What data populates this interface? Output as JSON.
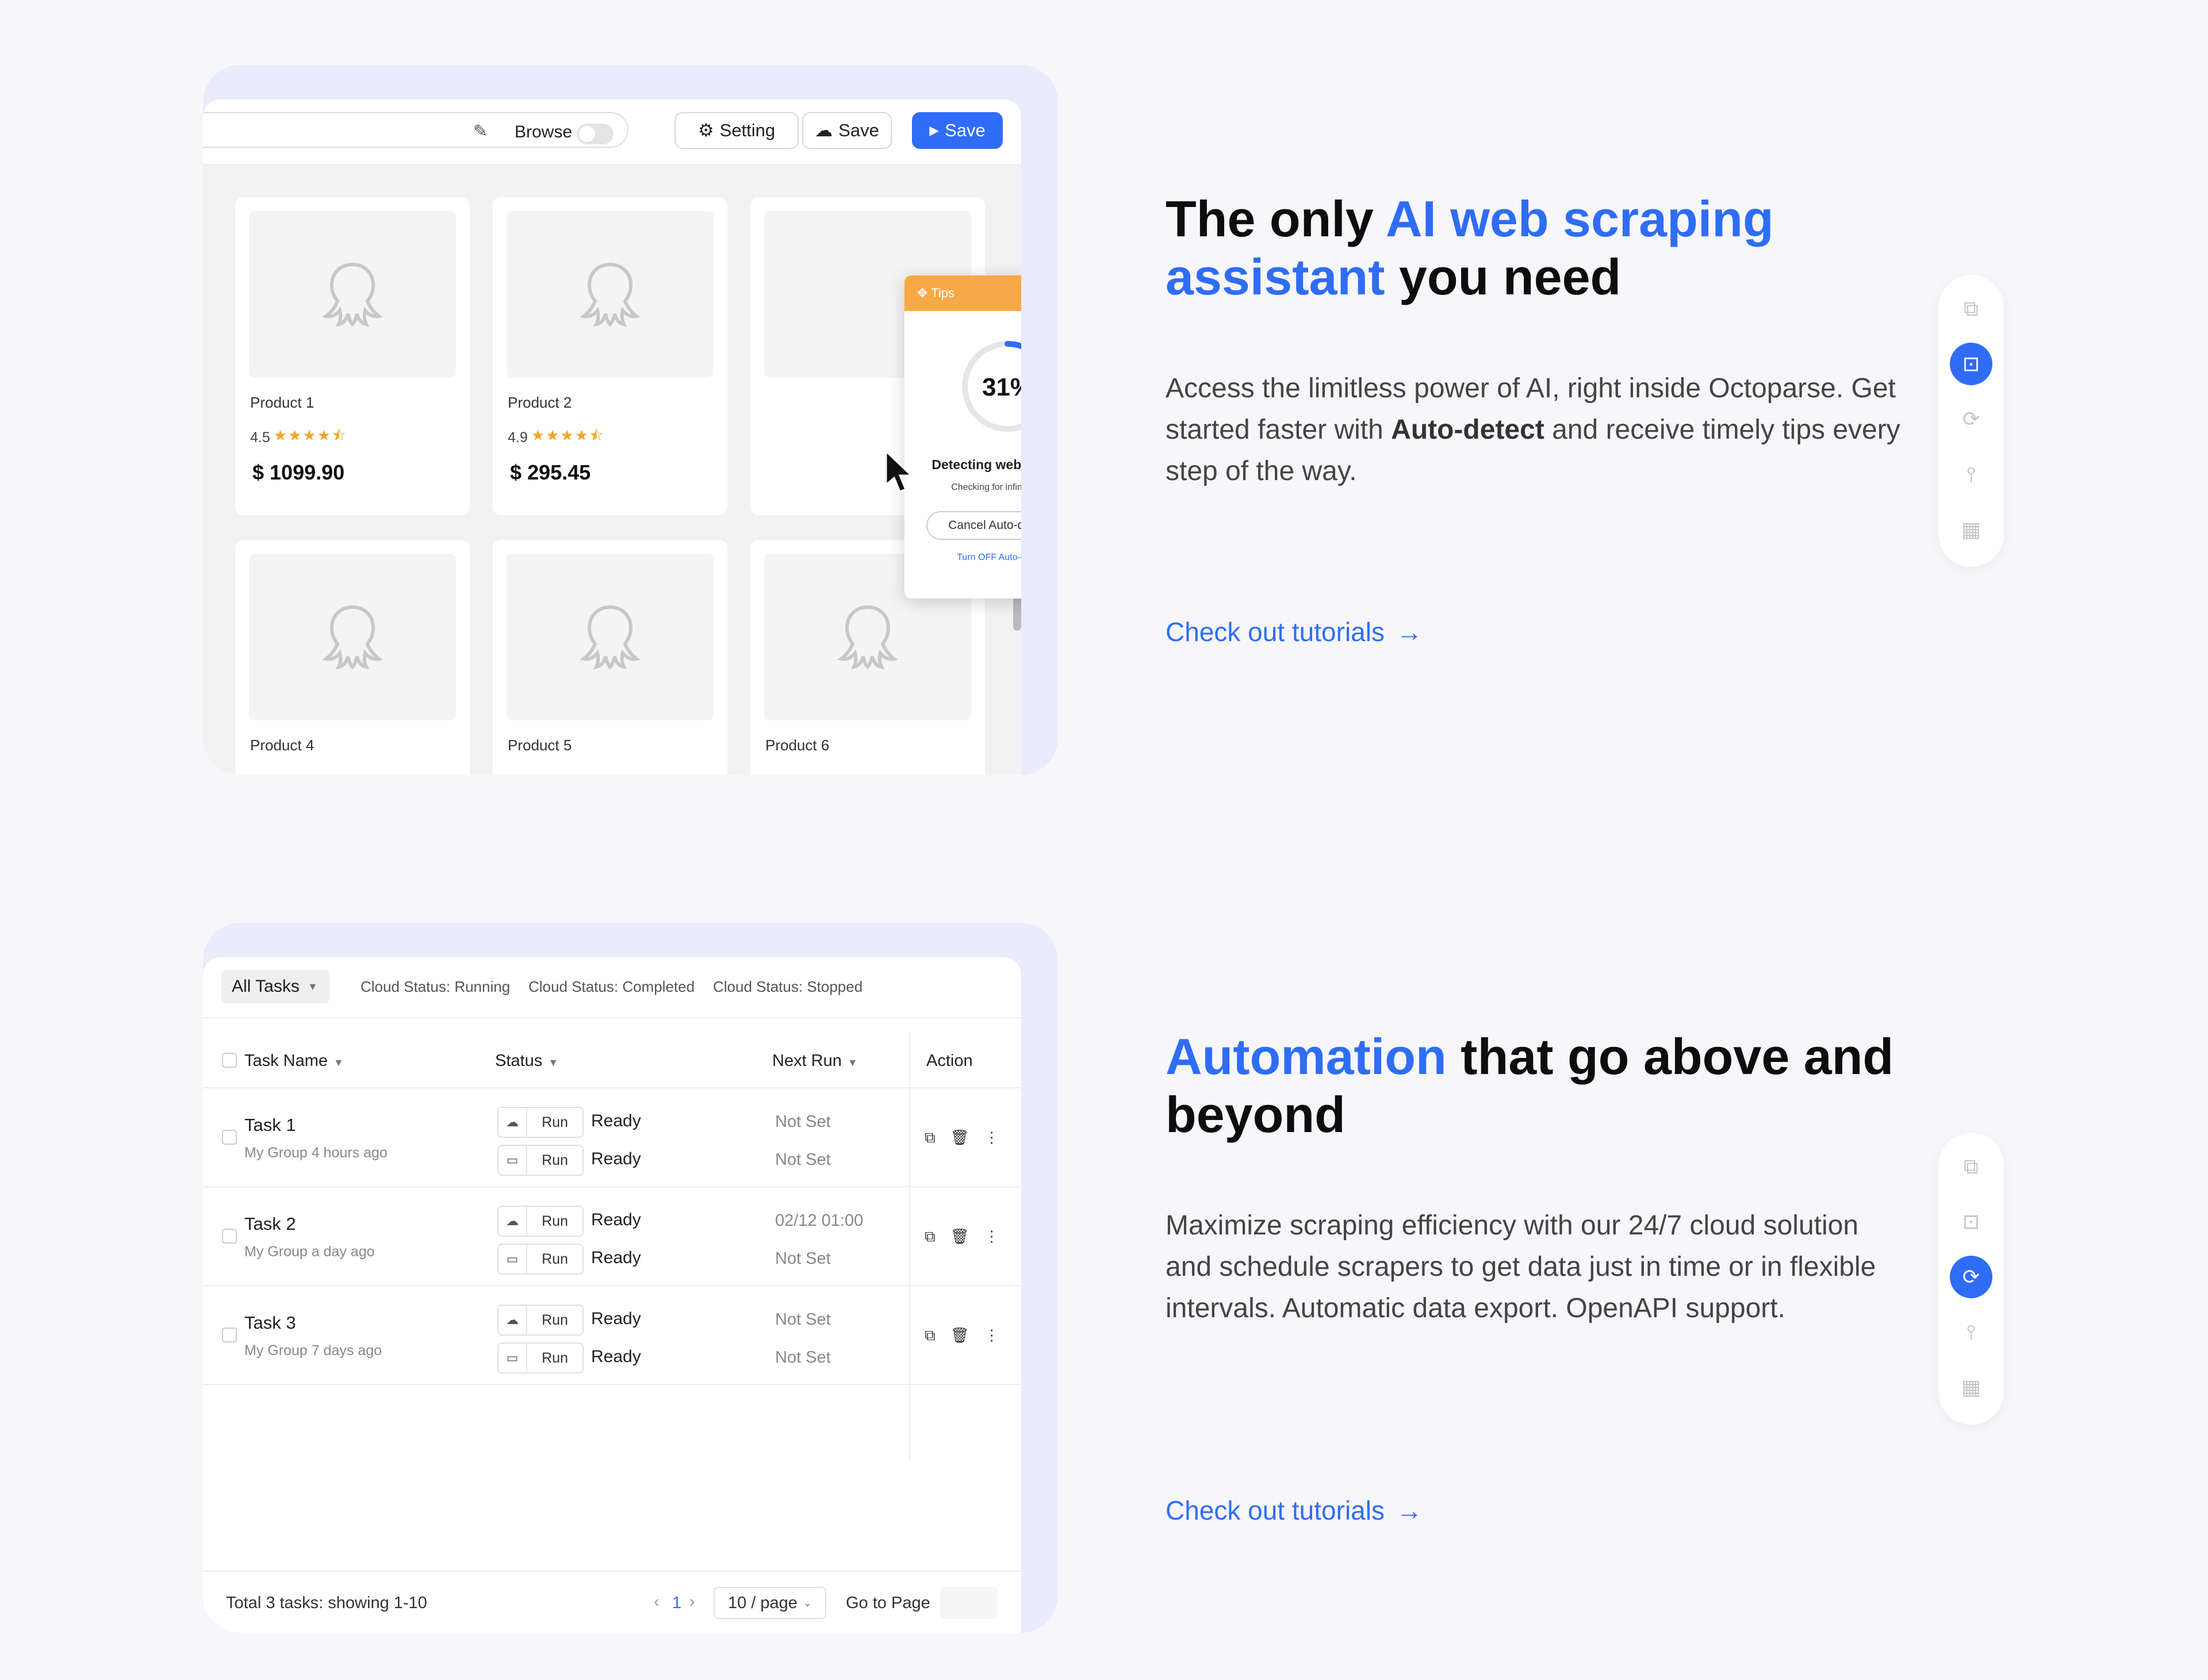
{
  "section1": {
    "mockup": {
      "toolbar": {
        "browse_label": "Browse",
        "setting_label": "Setting",
        "save_label": "Save",
        "save_primary_label": "Save"
      },
      "products": [
        {
          "name": "Product 1",
          "rating": "4.5",
          "price": "$ 1099.90"
        },
        {
          "name": "Product 2",
          "rating": "4.9",
          "price": "$ 295.45"
        },
        {
          "name": "Product 4"
        },
        {
          "name": "Product 5"
        },
        {
          "name": "Product 6"
        }
      ],
      "tips": {
        "title": "Tips",
        "percent": "31%",
        "progress": 0.31,
        "heading": "Detecting webpage data",
        "subtext": "Checking for infinite scroll...",
        "cancel_label": "Cancel Auto-detection",
        "turn_off_label": "Turn OFF Auto-detection"
      }
    },
    "heading": {
      "pre": "The only ",
      "accent": "AI web scraping assistant",
      "post": " you need"
    },
    "paragraph": {
      "pre": "Access the limitless power of AI, right inside Octoparse. Get started faster with ",
      "bold": "Auto-detect",
      "post": " and receive timely tips every step of the way."
    },
    "link": "Check out tutorials",
    "rail_active_index": 1
  },
  "section2": {
    "mockup": {
      "filters": {
        "all_tasks": "All Tasks",
        "running": "Cloud Status: Running",
        "completed": "Cloud Status: Completed",
        "stopped": "Cloud Status: Stopped"
      },
      "columns": {
        "task_name": "Task Name",
        "status": "Status",
        "next_run": "Next Run",
        "action": "Action"
      },
      "tasks": [
        {
          "name": "Task 1",
          "meta": "My Group 4 hours ago",
          "run1": "Run",
          "status1": "Ready",
          "next1": "Not Set",
          "run2": "Run",
          "status2": "Ready",
          "next2": "Not Set"
        },
        {
          "name": "Task 2",
          "meta": "My Group a day ago",
          "run1": "Run",
          "status1": "Ready",
          "next1": "02/12 01:00",
          "run2": "Run",
          "status2": "Ready",
          "next2": "Not Set"
        },
        {
          "name": "Task 3",
          "meta": "My Group 7 days ago",
          "run1": "Run",
          "status1": "Ready",
          "next1": "Not Set",
          "run2": "Run",
          "status2": "Ready",
          "next2": "Not Set"
        }
      ],
      "footer": {
        "summary": "Total 3 tasks: showing 1-10",
        "page": "1",
        "page_size": "10 / page",
        "goto_label": "Go to Page"
      }
    },
    "heading": {
      "accent": "Automation",
      "post": " that go above and beyond"
    },
    "paragraph": "Maximize scraping efficiency with our 24/7 cloud solution and schedule scrapers to get data just in time or in flexible intervals. Automatic data export. OpenAPI support.",
    "link": "Check out tutorials",
    "rail_active_index": 2
  },
  "colors": {
    "accent": "#2f6df6",
    "tips_orange": "#f8a947",
    "star": "#f5a524"
  },
  "icons": [
    "convert-icon",
    "ai-detect-icon",
    "cloud-sync-icon",
    "sliders-icon",
    "dashboard-icon"
  ]
}
